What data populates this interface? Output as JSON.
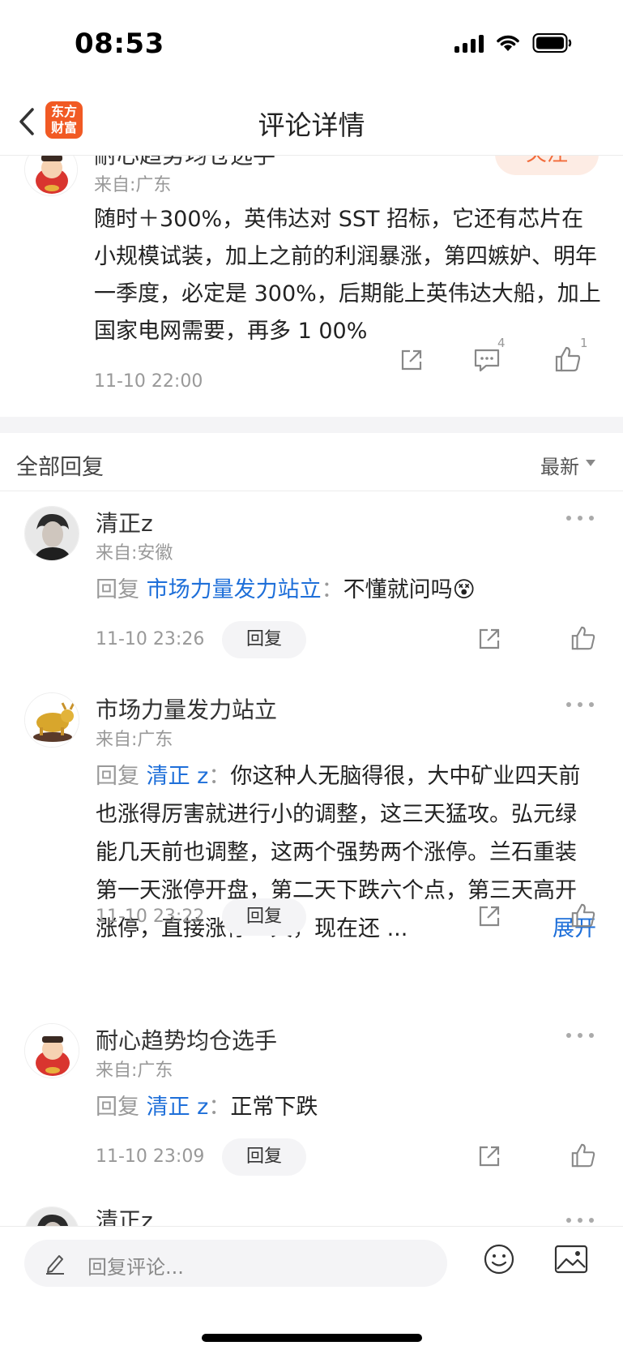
{
  "status_bar": {
    "time": "08:53"
  },
  "nav": {
    "logo_line1": "东方",
    "logo_line2": "财富",
    "title": "评论详情"
  },
  "main_comment": {
    "author": "耐心趋势均仓选手",
    "follow_label": "关注",
    "location": "来自:广东",
    "text": "随时＋300%，英伟达对 SST 招标，它还有芯片在小规模试装，加上之前的利润暴涨，第四嫉妒、明年一季度，必定是 300%，后期能上英伟达大船，加上国家电网需要，再多 1 00%",
    "time": "11-10 22:00",
    "comment_count": "4",
    "like_count": "1"
  },
  "replies_header": {
    "title": "全部回复",
    "sort": "最新"
  },
  "replies": [
    {
      "name": "清正z",
      "location": "来自:安徽",
      "prefix": "回复",
      "target": "市场力量发力站立",
      "sep": "：",
      "content": "不懂就问吗",
      "emoji": "😵",
      "time": "11-10 23:26",
      "reply_label": "回复"
    },
    {
      "name": "市场力量发力站立",
      "location": "来自:广东",
      "prefix": "回复",
      "target": "清正 z",
      "sep": "：",
      "content": "你这种人无脑得很，大中矿业四天前也涨得厉害就进行小的调整，这三天猛攻。弘元绿能几天前也调整，这两个强势两个涨停。兰石重装第一天涨停开盘，第二天下跌六个点，第三天高开涨停，直接涨停三天，现在还 ...",
      "expand": "展开",
      "time": "11-10 23:22",
      "reply_label": "回复"
    },
    {
      "name": "耐心趋势均仓选手",
      "location": "来自:广东",
      "prefix": "回复",
      "target": "清正 z",
      "sep": "：",
      "content": "正常下跌",
      "time": "11-10 23:09",
      "reply_label": "回复"
    },
    {
      "name": "清正z"
    }
  ],
  "bottom_bar": {
    "placeholder": "回复评论..."
  }
}
